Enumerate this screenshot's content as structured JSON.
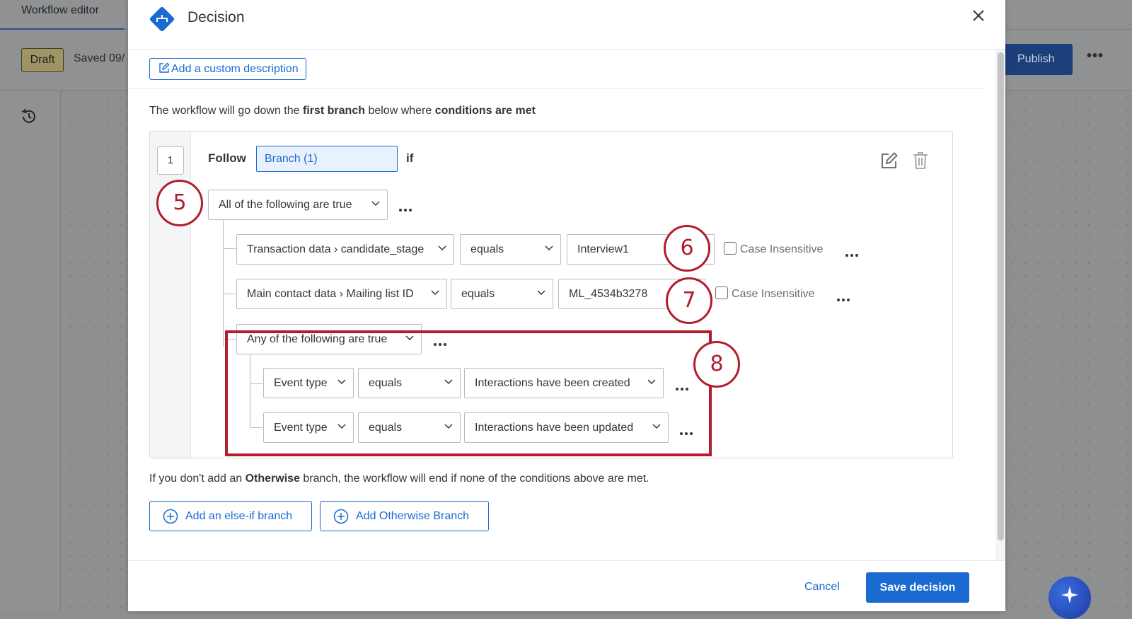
{
  "background": {
    "tab_label": "Workflow editor",
    "draft_badge": "Draft",
    "saved_text": "Saved 09/",
    "publish_label": "Publish",
    "more_label": "•••"
  },
  "modal": {
    "title": "Decision",
    "add_description_label": "Add a custom description",
    "intro": {
      "p1": "The workflow will go down the ",
      "b1": "first branch",
      "p2": " below where ",
      "b2": "conditions are met"
    },
    "branch": {
      "number": "1",
      "follow_label": "Follow",
      "branch_name": "Branch (1)",
      "if_label": "if",
      "group_operator": "All of the following are true",
      "conditions": [
        {
          "field": "Transaction data › candidate_stage",
          "operator": "equals",
          "value": "Interview1",
          "case_insensitive_label": "Case Insensitive"
        },
        {
          "field": "Main contact data › Mailing list ID",
          "operator": "equals",
          "value": "ML_4534b3278",
          "case_insensitive_label": "Case Insensitive"
        }
      ],
      "subgroup": {
        "operator": "Any of the following are true",
        "conditions": [
          {
            "field": "Event type",
            "operator": "equals",
            "value": "Interactions have been created"
          },
          {
            "field": "Event type",
            "operator": "equals",
            "value": "Interactions have been updated"
          }
        ]
      }
    },
    "footnote": {
      "p1": "If you don't add an ",
      "b1": "Otherwise",
      "p2": " branch, the workflow will end if none of the conditions above are met."
    },
    "add_else_if_label": "Add an else-if branch",
    "add_otherwise_label": "Add Otherwise Branch",
    "cancel_label": "Cancel",
    "save_label": "Save decision"
  },
  "callouts": [
    "5",
    "6",
    "7",
    "8"
  ],
  "colors": {
    "accent": "#1a6ad1",
    "callout": "#b11d2e",
    "decision_icon": "#1a6ad1"
  }
}
